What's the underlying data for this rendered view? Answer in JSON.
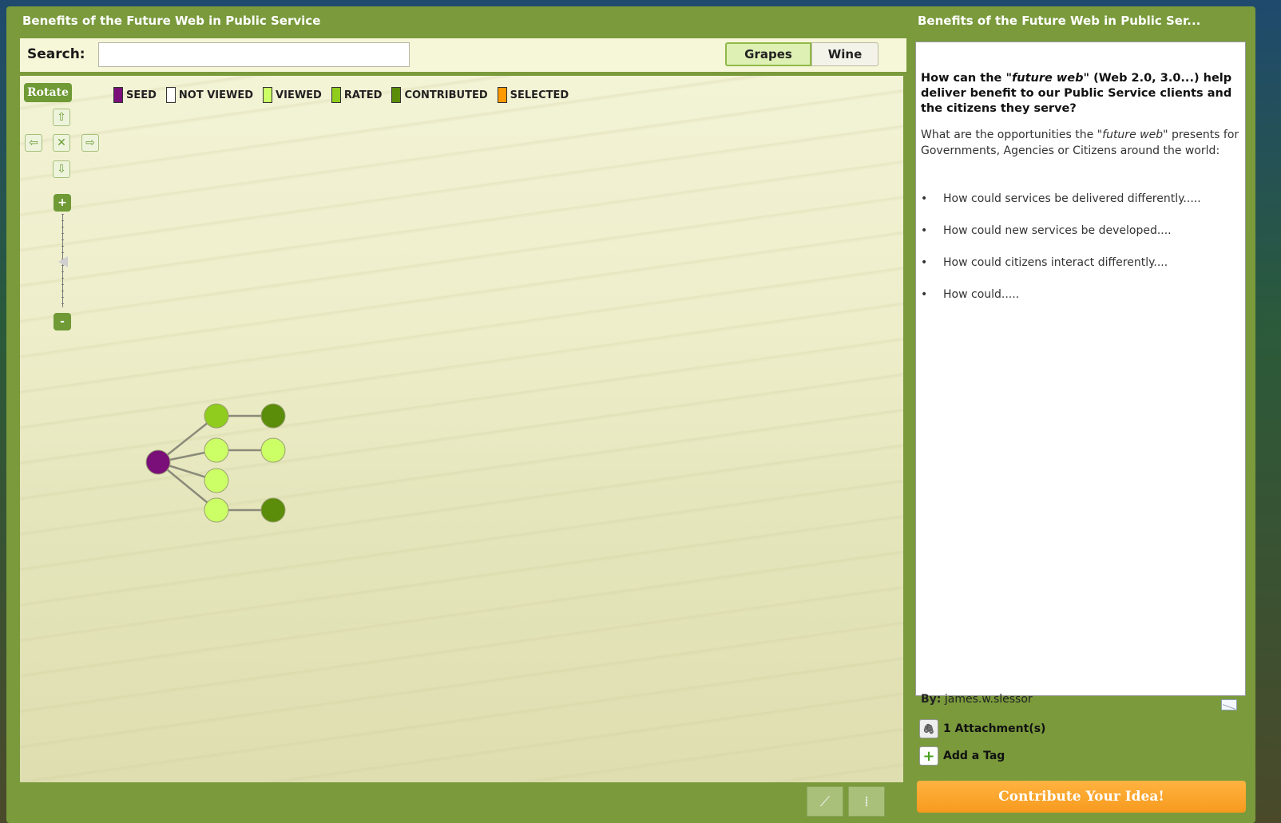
{
  "left_panel": {
    "title": "Benefits of the Future Web in Public Service",
    "search": {
      "label": "Search:",
      "value": "",
      "placeholder": ""
    },
    "toggle": {
      "grapes_label": "Grapes",
      "wine_label": "Wine",
      "selected": "Grapes"
    },
    "controls": {
      "rotate_label": "Rotate",
      "zoom_in_label": "+",
      "zoom_out_label": "-",
      "zoom_level": 0.5
    },
    "legend": [
      {
        "label": "SEED",
        "color": "#7a0f7a"
      },
      {
        "label": "NOT VIEWED",
        "color": "#ffffff"
      },
      {
        "label": "VIEWED",
        "color": "#ccff66"
      },
      {
        "label": "RATED",
        "color": "#8fcc1e"
      },
      {
        "label": "CONTRIBUTED",
        "color": "#5b8c0a"
      },
      {
        "label": "SELECTED",
        "color": "#ff9900"
      }
    ],
    "graph": {
      "nodes": [
        {
          "id": "seed",
          "status": "seed",
          "color": "#7a0f7a"
        },
        {
          "id": "n1",
          "status": "rated",
          "color": "#8fcc1e"
        },
        {
          "id": "n2",
          "status": "viewed",
          "color": "#ccff66"
        },
        {
          "id": "n3",
          "status": "viewed",
          "color": "#ccff66"
        },
        {
          "id": "n4",
          "status": "viewed",
          "color": "#ccff66"
        },
        {
          "id": "c1",
          "status": "contributed",
          "color": "#5b8c0a"
        },
        {
          "id": "c2",
          "status": "viewed",
          "color": "#ccff66"
        },
        {
          "id": "c4",
          "status": "contributed",
          "color": "#5b8c0a"
        }
      ],
      "edges": [
        [
          "seed",
          "n1"
        ],
        [
          "seed",
          "n2"
        ],
        [
          "seed",
          "n3"
        ],
        [
          "seed",
          "n4"
        ],
        [
          "n1",
          "c1"
        ],
        [
          "n2",
          "c2"
        ],
        [
          "n4",
          "c4"
        ]
      ]
    },
    "view_buttons": [
      {
        "name": "graph-view-icon",
        "glyph": "⟋"
      },
      {
        "name": "list-view-icon",
        "glyph": "⁞"
      }
    ]
  },
  "right_panel": {
    "title": "Benefits of the Future Web in Public Ser...",
    "question": {
      "prefix": "How can the ",
      "emphasis": "\"future web\"",
      "suffix": " (Web 2.0, 3.0...) help deliver benefit to our Public Service clients and the citizens they serve?"
    },
    "intro": {
      "prefix": "What are the opportunities the ",
      "emphasis": "\"future web\"",
      "suffix": " presents for Governments, Agencies or Citizens around the world:"
    },
    "bullets": [
      "How could services be delivered differently.....",
      "How could new services be developed....",
      "How could citizens interact differently....",
      "How could....."
    ],
    "author_label": "By:",
    "author": "james.w.slessor",
    "attachments_label": "1 Attachment(s)",
    "add_tag_label": "Add a Tag",
    "contribute_label": "Contribute Your Idea!"
  }
}
